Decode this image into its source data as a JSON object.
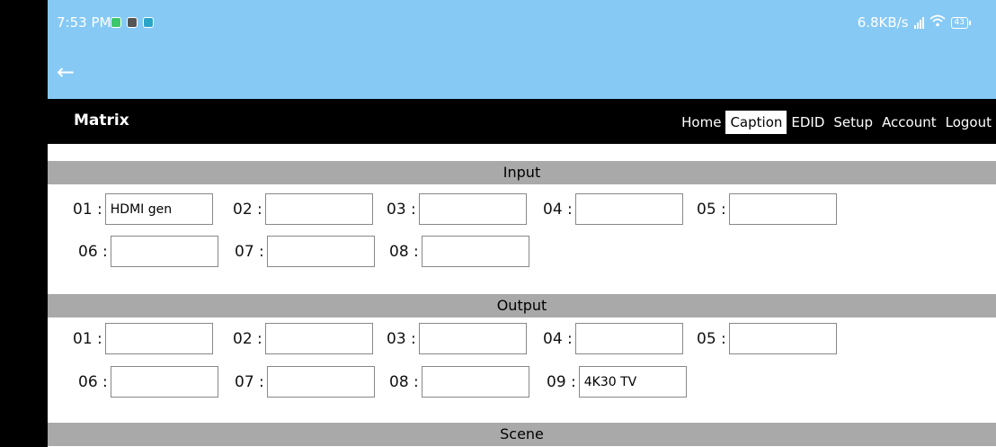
{
  "status_bar": {
    "time": "7:53 PM",
    "network_speed": "6.8KB/s",
    "battery_level": "43"
  },
  "header": {
    "brand": "Matrix"
  },
  "nav": {
    "items": [
      "Home",
      "Caption",
      "EDID",
      "Setup",
      "Account",
      "Logout"
    ],
    "active": "Caption"
  },
  "input": {
    "title": "Input",
    "fields": [
      {
        "label": "01 :",
        "value": "HDMI gen"
      },
      {
        "label": "02 :",
        "value": ""
      },
      {
        "label": "03 :",
        "value": ""
      },
      {
        "label": "04 :",
        "value": ""
      },
      {
        "label": "05 :",
        "value": ""
      },
      {
        "label": "06 :",
        "value": ""
      },
      {
        "label": "07 :",
        "value": ""
      },
      {
        "label": "08 :",
        "value": ""
      }
    ]
  },
  "output": {
    "title": "Output",
    "fields": [
      {
        "label": "01 :",
        "value": ""
      },
      {
        "label": "02 :",
        "value": ""
      },
      {
        "label": "03 :",
        "value": ""
      },
      {
        "label": "04 :",
        "value": ""
      },
      {
        "label": "05 :",
        "value": ""
      },
      {
        "label": "06 :",
        "value": ""
      },
      {
        "label": "07 :",
        "value": ""
      },
      {
        "label": "08 :",
        "value": ""
      },
      {
        "label": "09 :",
        "value": "4K30 TV"
      }
    ]
  },
  "scene": {
    "title": "Scene"
  }
}
